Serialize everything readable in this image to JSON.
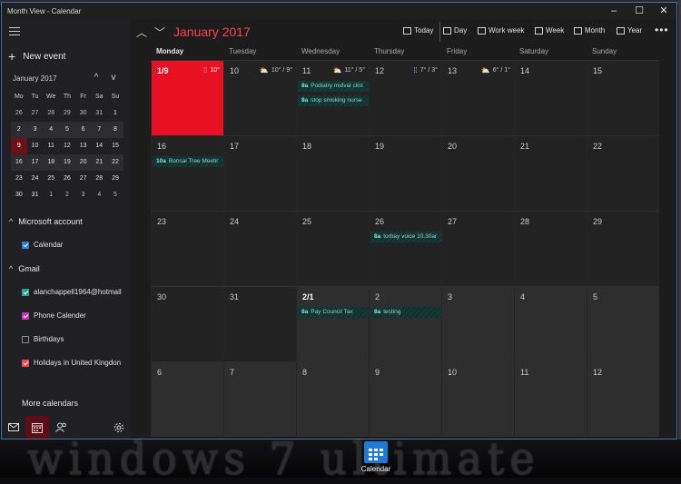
{
  "window": {
    "title": "Month View - Calendar",
    "minimize": "–",
    "maximize": "☐",
    "close": "✕"
  },
  "sidebar": {
    "new_event": "New event",
    "mini_calendar": {
      "month_label": "January 2017",
      "prev": "^",
      "next": "v",
      "dow": [
        "Mo",
        "Tu",
        "We",
        "Th",
        "Fr",
        "Sa",
        "Su"
      ],
      "weeks": [
        [
          "26",
          "27",
          "28",
          "29",
          "30",
          "31",
          "1"
        ],
        [
          "2",
          "3",
          "4",
          "5",
          "6",
          "7",
          "8"
        ],
        [
          "9",
          "10",
          "11",
          "12",
          "13",
          "14",
          "15"
        ],
        [
          "16",
          "17",
          "18",
          "19",
          "20",
          "21",
          "22"
        ],
        [
          "23",
          "24",
          "25",
          "26",
          "27",
          "28",
          "29"
        ],
        [
          "30",
          "31",
          "1",
          "2",
          "3",
          "4",
          "5"
        ]
      ]
    },
    "accounts": [
      {
        "name": "Microsoft account",
        "calendars": [
          {
            "label": "Calendar",
            "checked": true,
            "color": "#2d7fd6"
          }
        ]
      },
      {
        "name": "Gmail",
        "calendars": [
          {
            "label": "alanchappell1964@hotmail",
            "checked": true,
            "color": "#2aa18f"
          },
          {
            "label": "Phone Calender",
            "checked": true,
            "color": "#c239b3"
          },
          {
            "label": "Birthdays",
            "checked": false,
            "color": "#888888"
          },
          {
            "label": "Holidays in United Kingdon",
            "checked": true,
            "color": "#e74856"
          }
        ]
      }
    ],
    "more_calendars": "More calendars",
    "bottom_icons": [
      "mail-icon",
      "calendar-icon",
      "people-icon",
      "settings-icon"
    ]
  },
  "toolbar": {
    "month_title": "January 2017",
    "today": "Today",
    "day": "Day",
    "work_week": "Work week",
    "week": "Week",
    "month": "Month",
    "year": "Year",
    "more": "•••"
  },
  "grid": {
    "dow": [
      "Monday",
      "Tuesday",
      "Wednesday",
      "Thursday",
      "Friday",
      "Saturday",
      "Sunday"
    ],
    "weeks": [
      [
        "1/9",
        "10",
        "11",
        "12",
        "13",
        "14",
        "15"
      ],
      [
        "16",
        "17",
        "18",
        "19",
        "20",
        "21",
        "22"
      ],
      [
        "23",
        "24",
        "25",
        "26",
        "27",
        "28",
        "29"
      ],
      [
        "30",
        "31",
        "2/1",
        "2",
        "3",
        "4",
        "5"
      ],
      [
        "6",
        "7",
        "8",
        "9",
        "10",
        "11",
        "12"
      ]
    ],
    "weather": {
      "w0d0": "10°",
      "w0d1": "10° / 9°",
      "w0d2": "11° / 5°",
      "w0d3": "7° / 3°",
      "w0d4": "6° / 1°"
    },
    "events": {
      "podiatry": {
        "time": "8a",
        "title": "Podiatry midval clini"
      },
      "smoking": {
        "time": "8a",
        "title": "stop smoking nurse"
      },
      "bonsai": {
        "time": "10a",
        "title": "Bonsai Tree Meetir"
      },
      "torbay": {
        "time": "8a",
        "title": "torbay voice 10.30ar"
      },
      "council": {
        "time": "8a",
        "title": "Pay Council  Tax"
      },
      "testing": {
        "time": "8a",
        "title": "testing"
      }
    }
  },
  "desktop": {
    "wallpaper_text": "windows 7 ultimate",
    "taskbar_app": "Calendar"
  },
  "colors": {
    "accent": "#e81123",
    "title_red": "#ff3f55",
    "event_teal": "#8fd3c8"
  }
}
